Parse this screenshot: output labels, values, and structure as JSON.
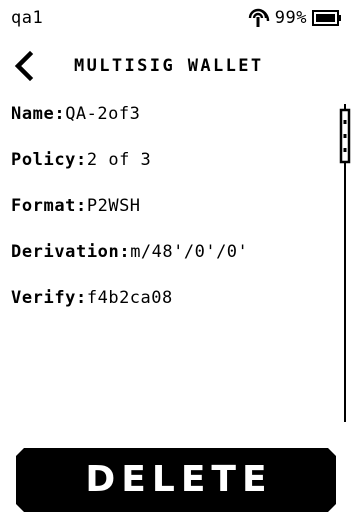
{
  "status_bar": {
    "device_name": "qa1",
    "battery_percent": "99%",
    "icons": [
      "nfc-icon",
      "battery-icon"
    ]
  },
  "header": {
    "title": "MULTISIG WALLET",
    "back_icon": "chevron-left-icon"
  },
  "fields": [
    {
      "label": "Name:",
      "value": "QA-2of3"
    },
    {
      "label": "Policy:",
      "value": "2 of 3"
    },
    {
      "label": "Format:",
      "value": "P2WSH"
    },
    {
      "label": "Derivation:",
      "value": "m/48'/0'/0'"
    },
    {
      "label": "Verify:",
      "value": "f4b2ca08"
    }
  ],
  "actions": {
    "delete_label": "DELETE"
  },
  "colors": {
    "foreground": "#000000",
    "background": "#ffffff"
  }
}
